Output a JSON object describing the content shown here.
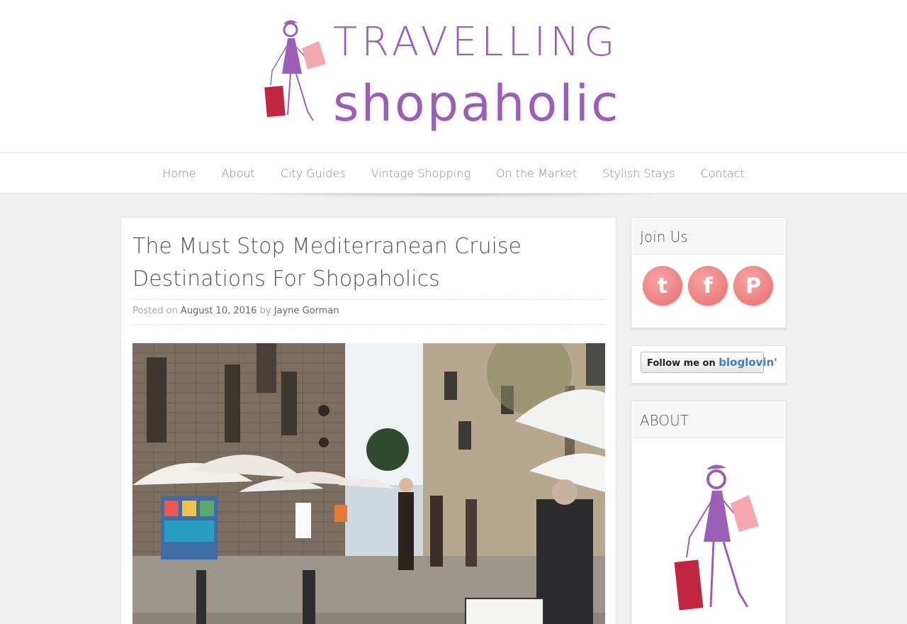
{
  "site": {
    "logo_line1": "TRAVELLING",
    "logo_line2": "shopaholic"
  },
  "nav": {
    "items": [
      "Home",
      "About",
      "City Guides",
      "Vintage Shopping",
      "On the Market",
      "Stylish Stays",
      "Contact"
    ]
  },
  "article": {
    "title": "The Must Stop Mediterranean Cruise Destinations For Shopaholics",
    "posted_on_label": "Posted on",
    "date": "August 10, 2016",
    "by_label": "by",
    "author": "Jayne Gorman"
  },
  "sidebar": {
    "join_title": "Join Us",
    "social": [
      "twitter-icon",
      "facebook-icon",
      "pinterest-icon"
    ],
    "bloglovin_prefix": "Follow me on",
    "bloglovin_brand": "bloglovin'",
    "about_title": "ABOUT"
  },
  "colors": {
    "brand_purple": "#9b5fb8",
    "social_pink": "#ee7e7e",
    "bag_red": "#c0263f"
  }
}
